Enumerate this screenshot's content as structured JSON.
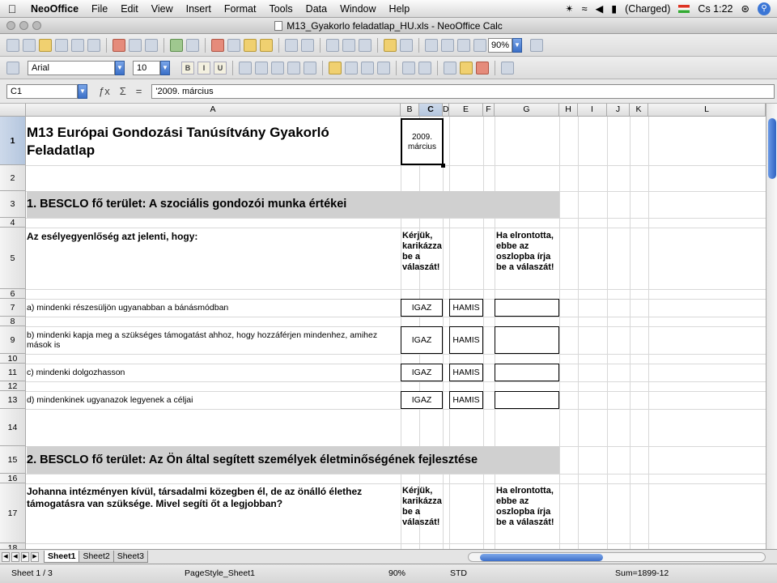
{
  "menubar": {
    "app_name": "NeoOffice",
    "menus": [
      "File",
      "Edit",
      "View",
      "Insert",
      "Format",
      "Tools",
      "Data",
      "Window",
      "Help"
    ],
    "battery": "(Charged)",
    "clock": "Cs 1:22"
  },
  "window": {
    "title": "M13_Gyakorlo feladatlap_HU.xls - NeoOffice Calc"
  },
  "toolbar": {
    "zoom": "90%"
  },
  "format_toolbar": {
    "font_name": "Arial",
    "font_size": "10"
  },
  "formula_bar": {
    "cell_ref": "C1",
    "content": "'2009. március"
  },
  "columns": [
    "A",
    "B",
    "C",
    "D",
    "E",
    "F",
    "G",
    "H",
    "I",
    "J",
    "K",
    "L"
  ],
  "selected_column": "C",
  "rows": [
    "1",
    "2",
    "3",
    "4",
    "5",
    "6",
    "7",
    "8",
    "9",
    "10",
    "11",
    "12",
    "13",
    "14",
    "15",
    "16",
    "17",
    "18"
  ],
  "sheet": {
    "title": "M13 Európai Gondozási Tanúsítvány Gyakorló Feladatlap",
    "date_cell": "2009. március",
    "section1": "1. BESCLO fő terület: A szociális gondozói munka értékei",
    "question1": "Az esélyegyenlőség azt jelenti, hogy:",
    "instruction_circle": "Kérjük, karikázza be a válaszát!",
    "instruction_error": "Ha elrontotta, ebbe az oszlopba írja be a válaszát!",
    "items": [
      {
        "text": "a) mindenki részesüljön ugyanabban a bánásmódban",
        "true_label": "IGAZ",
        "false_label": "HAMIS"
      },
      {
        "text": "b) mindenki kapja meg a szükséges támogatást ahhoz, hogy hozzáférjen mindenhez, amihez mások is",
        "true_label": "IGAZ",
        "false_label": "HAMIS"
      },
      {
        "text": "c) mindenki dolgozhasson",
        "true_label": "IGAZ",
        "false_label": "HAMIS"
      },
      {
        "text": "d) mindenkinek ugyanazok legyenek a céljai",
        "true_label": "IGAZ",
        "false_label": "HAMIS"
      }
    ],
    "section2": "2. BESCLO fő terület: Az Ön által segített személyek életminőségének fejlesztése",
    "question2": "Johanna intézményen kívül, társadalmi közegben él, de az önálló élethez támogatásra van szüksége. Mivel segíti őt a legjobban?",
    "instruction_circle2": "Kérjük, karikázza be a válaszát!",
    "instruction_error2": "Ha elrontotta, ebbe az oszlopba írja be a válaszát!"
  },
  "tabs": [
    "Sheet1",
    "Sheet2",
    "Sheet3"
  ],
  "status": {
    "sheet": "Sheet 1 / 3",
    "page_style": "PageStyle_Sheet1",
    "zoom": "90%",
    "mode": "STD",
    "sum": "Sum=1899-12"
  }
}
